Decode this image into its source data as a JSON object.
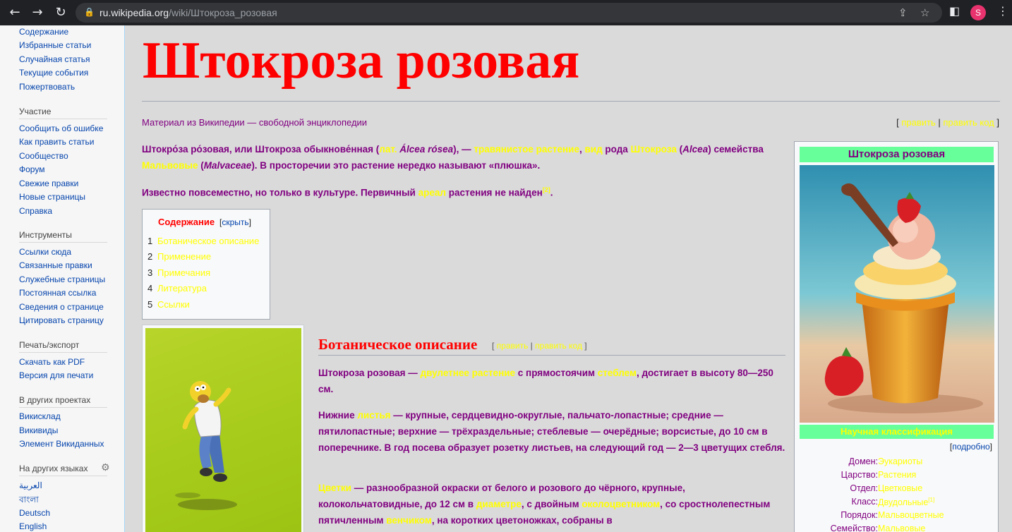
{
  "browser": {
    "url_host": "ru.wikipedia.org",
    "url_path": "/wiki/Штокроза_розовая",
    "profile_initial": "S"
  },
  "sidebar": {
    "nav": [
      "Содержание",
      "Избранные статьи",
      "Случайная статья",
      "Текущие события",
      "Пожертвовать"
    ],
    "participation_head": "Участие",
    "participation": [
      "Сообщить об ошибке",
      "Как править статьи",
      "Сообщество",
      "Форум",
      "Свежие правки",
      "Новые страницы",
      "Справка"
    ],
    "tools_head": "Инструменты",
    "tools": [
      "Ссылки сюда",
      "Связанные правки",
      "Служебные страницы",
      "Постоянная ссылка",
      "Сведения о странице",
      "Цитировать страницу"
    ],
    "print_head": "Печать/экспорт",
    "print": [
      "Скачать как PDF",
      "Версия для печати"
    ],
    "projects_head": "В других проектах",
    "projects": [
      "Викисклад",
      "Викивиды",
      "Элемент Викиданных"
    ],
    "languages_head": "На других языках",
    "languages": [
      "العربية",
      "বাংলা",
      "Deutsch",
      "English"
    ]
  },
  "article": {
    "title": "Штокроза розовая",
    "tagline": "Материал из Википедии — свободной энциклопедии",
    "edit": "править",
    "edit_code": "править код",
    "intro": {
      "t1": "Штокро́за ро́зовая, или Штокроза обыкнове́нная (",
      "lat": "лат.",
      "t2": " Álcea rósea",
      "t3": "), — ",
      "herb": "травянистое растение",
      "t4": ", ",
      "species": "вид",
      "t5": " рода ",
      "genus": "Штокроза",
      "t6": " (",
      "alcea": "Alcea",
      "t7": ") семейства ",
      "family": "Мальвовые",
      "t8": " (",
      "malvaceae": "Malvaceae",
      "t9": "). В просторечии это растение нередко называют «плюшка»."
    },
    "intro2": {
      "t1": "Известно повсеместно, но только в культуре. Первичный ",
      "areal": "ареал",
      "t2": " растения не найден",
      "ref": "[2]",
      "t3": "."
    },
    "toc": {
      "title": "Содержание",
      "hide": "скрыть",
      "items": [
        {
          "num": "1",
          "text": "Ботаническое описание"
        },
        {
          "num": "2",
          "text": "Применение"
        },
        {
          "num": "3",
          "text": "Примечания"
        },
        {
          "num": "4",
          "text": "Литература"
        },
        {
          "num": "5",
          "text": "Ссылки"
        }
      ]
    },
    "section": {
      "title": "Ботаническое описание",
      "p1": {
        "t1": "Штокроза розовая — ",
        "biennial": "двулетнее растение",
        "t2": " с прямостоячим ",
        "stem": "стеблем",
        "t3": ", достигает в высоту 80—250 см."
      },
      "p2": {
        "t1": "Нижние ",
        "leaves": "листья",
        "t2": " — крупные, сердцевидно-округлые, пальчато-лопастные; средние — пятилопастные; верхние — трёхраздельные; стеблевые — очерёдные; ворсистые, до 10 см в поперечнике. В год посева образует розетку листьев, на следующий год — 2—3 цветущих стебля."
      },
      "p3": {
        "flowers": "Цветки",
        "t1": " — разнообразной окраски от белого и розового до чёрного, крупные, колокольчатовидные, до 12 см в ",
        "diameter": "диаметре",
        "t2": ", с двойным ",
        "perianth": "околоцветником",
        "t3": ", со сростнолепестным пятичленным ",
        "corolla": "венчиком",
        "t4": ", на коротких цветоножках, собраны в"
      }
    }
  },
  "infobox": {
    "title": "Штокроза розовая",
    "subtitle": "Научная классификация",
    "more": "подробно",
    "rows": [
      {
        "k": "Домен:",
        "v": "Эукариоты"
      },
      {
        "k": "Царство:",
        "v": "Растения"
      },
      {
        "k": "Отдел:",
        "v": "Цветковые"
      },
      {
        "k": "Класс:",
        "v": "Двудольные",
        "ref": "[1]"
      },
      {
        "k": "Порядок:",
        "v": "Мальвоцветные"
      },
      {
        "k": "Семейство:",
        "v": "Мальвовые"
      }
    ]
  }
}
